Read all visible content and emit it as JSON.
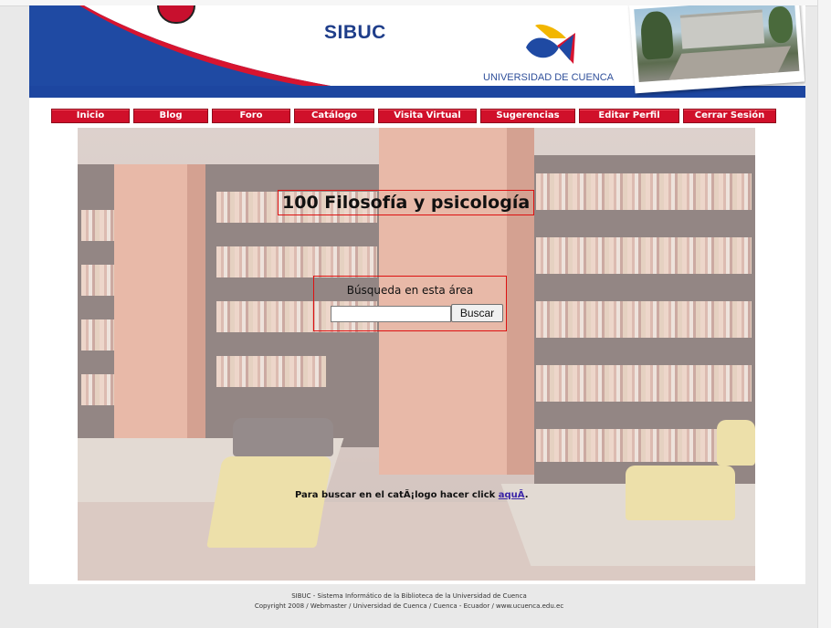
{
  "header": {
    "site_title": "SIBUC",
    "university_name": "UNIVERSIDAD DE CUENCA",
    "colors": {
      "brand_blue": "#1f3e8a",
      "brand_red": "#c8102e"
    }
  },
  "nav": {
    "items": [
      {
        "label": "Inicio"
      },
      {
        "label": "Blog"
      },
      {
        "label": "Foro"
      },
      {
        "label": "Catálogo"
      },
      {
        "label": "Visita Virtual"
      },
      {
        "label": "Sugerencias"
      },
      {
        "label": "Editar Perfil"
      },
      {
        "label": "Cerrar Sesión"
      }
    ],
    "color": "#d0102a"
  },
  "main": {
    "category_title": "100 Filosofía y psicología",
    "search": {
      "label": "Búsqueda en esta área",
      "input_value": "",
      "button_label": "Buscar"
    },
    "catalog_prompt": "Para buscar en el catÃ¡logo hacer click",
    "catalog_link": "aquÃ",
    "catalog_suffix": "."
  },
  "footer": {
    "line1": "SIBUC - Sistema Informático de la Biblioteca de la Universidad de Cuenca",
    "line2": "Copyright 2008 / Webmaster / Universidad de Cuenca / Cuenca - Ecuador / www.ucuenca.edu.ec"
  }
}
